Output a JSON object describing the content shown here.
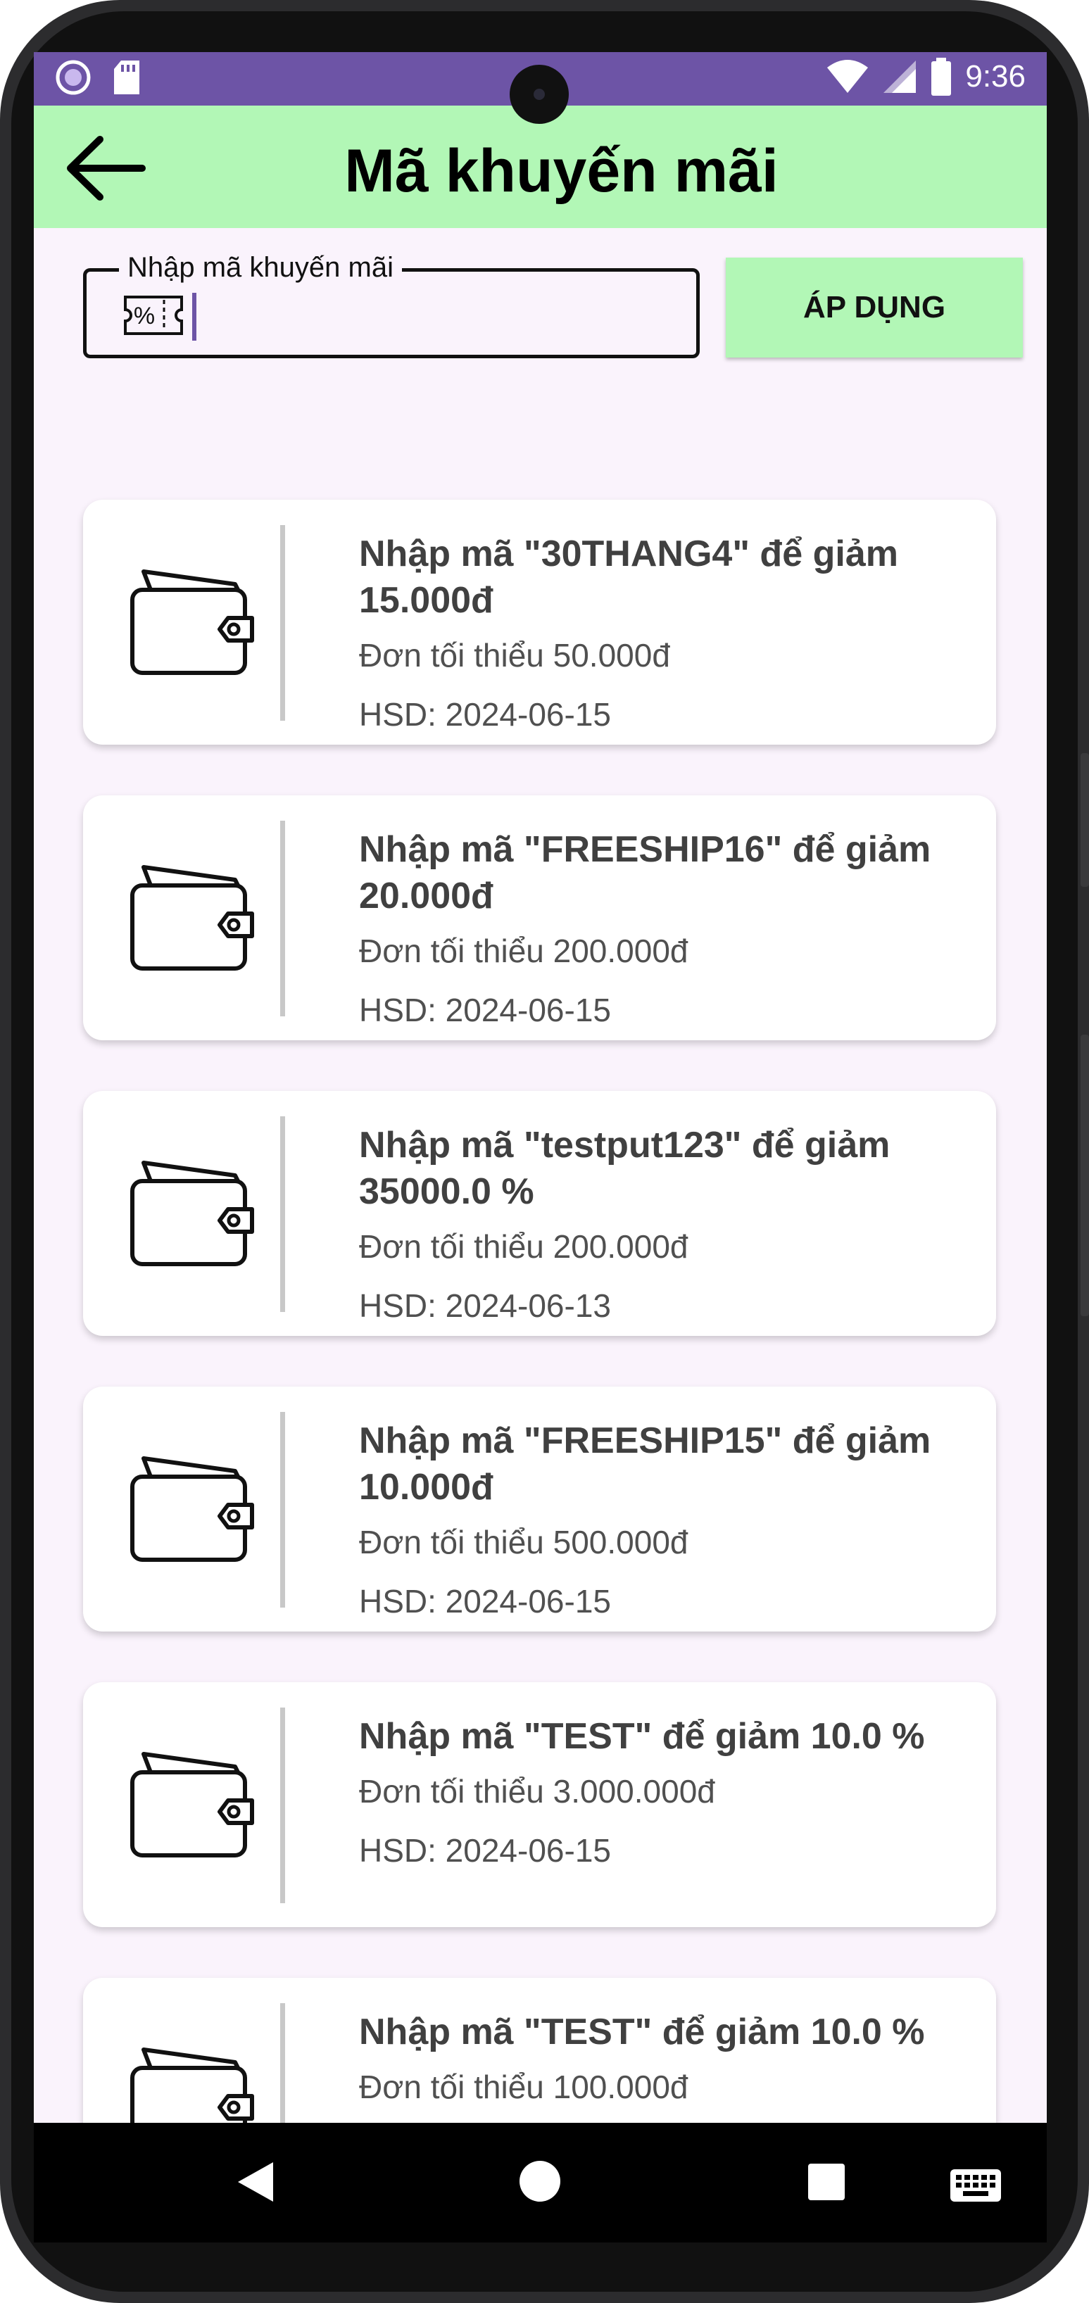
{
  "status_bar": {
    "time": "9:36",
    "left_icons": [
      "circle-notification-icon",
      "sd-card-icon"
    ],
    "right_icons": [
      "wifi-icon",
      "signal-icon",
      "battery-icon"
    ]
  },
  "header": {
    "title": "Mã khuyến mãi",
    "back_icon": "arrow-left-icon"
  },
  "promo_input": {
    "label": "Nhập mã khuyến mãi",
    "value": "",
    "icon": "coupon-percent-icon"
  },
  "apply_button": {
    "label": "ÁP DỤNG"
  },
  "vouchers": [
    {
      "title": "Nhập mã \"30THANG4\" để giảm 15.000đ",
      "min_order": "Đơn tối thiểu 50.000đ",
      "expiry": "HSD: 2024-06-15",
      "icon": "wallet-icon"
    },
    {
      "title": "Nhập mã \"FREESHIP16\" để giảm 20.000đ",
      "min_order": "Đơn tối thiểu 200.000đ",
      "expiry": "HSD: 2024-06-15",
      "icon": "wallet-icon"
    },
    {
      "title": "Nhập mã \"testput123\" để giảm 35000.0 %",
      "min_order": "Đơn tối thiểu 200.000đ",
      "expiry": "HSD: 2024-06-13",
      "icon": "wallet-icon"
    },
    {
      "title": "Nhập mã \"FREESHIP15\" để giảm 10.000đ",
      "min_order": "Đơn tối thiểu 500.000đ",
      "expiry": "HSD: 2024-06-15",
      "icon": "wallet-icon"
    },
    {
      "title": "Nhập mã \"TEST\" để giảm 10.0 %",
      "min_order": "Đơn tối thiểu 3.000.000đ",
      "expiry": "HSD: 2024-06-15",
      "icon": "wallet-icon"
    },
    {
      "title": "Nhập mã \"TEST\" để giảm 10.0 %",
      "min_order": "Đơn tối thiểu 100.000đ",
      "expiry": "",
      "icon": "wallet-icon"
    }
  ],
  "nav_bar": {
    "icons": [
      "back-triangle-icon",
      "home-circle-icon",
      "recents-square-icon",
      "keyboard-icon"
    ]
  },
  "colors": {
    "status_bar": "#6d54a6",
    "app_bar": "#b2f7b6",
    "background": "#faf3fc",
    "caret": "#6d54a6"
  }
}
